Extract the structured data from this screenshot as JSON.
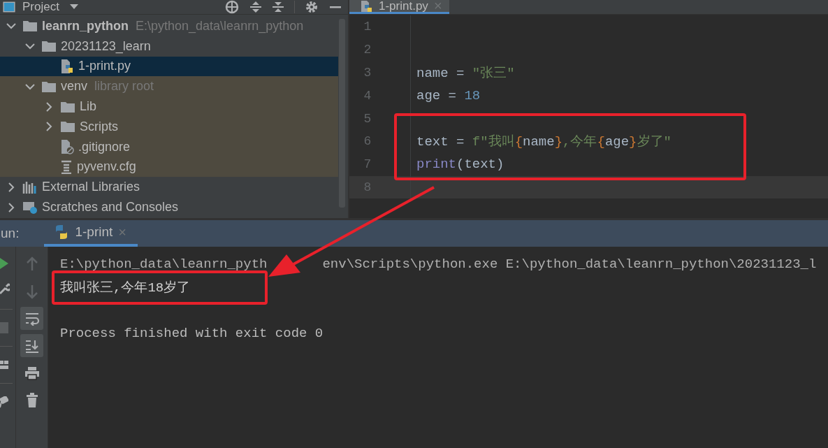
{
  "project_panel": {
    "title": "Project",
    "tree": [
      {
        "label": "leanrn_python",
        "hint": "E:\\python_data\\leanrn_python",
        "kind": "root",
        "expanded": true,
        "selected": false,
        "library": false,
        "children": [
          {
            "label": "20231123_learn",
            "kind": "folder",
            "expanded": true,
            "selected": false,
            "library": false,
            "children": [
              {
                "label": "1-print.py",
                "kind": "python",
                "selected": true
              }
            ]
          },
          {
            "label": "venv",
            "hint": "library root",
            "kind": "folder",
            "expanded": true,
            "selected": false,
            "library": true,
            "children": [
              {
                "label": "Lib",
                "kind": "folder",
                "expanded": false,
                "selected": false,
                "library": true
              },
              {
                "label": "Scripts",
                "kind": "folder",
                "expanded": false,
                "selected": false,
                "library": true
              },
              {
                "label": ".gitignore",
                "kind": "ignore",
                "selected": false,
                "library": true
              },
              {
                "label": "pyvenv.cfg",
                "kind": "config",
                "selected": false,
                "library": true
              }
            ]
          }
        ]
      },
      {
        "label": "External Libraries",
        "kind": "libraries",
        "expanded": false,
        "selected": false,
        "library": false
      },
      {
        "label": "Scratches and Consoles",
        "kind": "scratches",
        "expanded": false,
        "selected": false,
        "library": false
      }
    ]
  },
  "editor": {
    "tab": {
      "label": "1-print.py",
      "close": "×",
      "selected": true
    },
    "lines": [
      {
        "number": "1",
        "current": false
      },
      {
        "number": "2",
        "current": false
      },
      {
        "number": "3",
        "current": false,
        "tokens": [
          {
            "text": "name = ",
            "kind": "plain"
          },
          {
            "text": "\"张三\"",
            "kind": "string"
          }
        ]
      },
      {
        "number": "4",
        "current": false,
        "tokens": [
          {
            "text": "age = ",
            "kind": "plain"
          },
          {
            "text": "18",
            "kind": "number"
          }
        ]
      },
      {
        "number": "5",
        "current": false
      },
      {
        "number": "6",
        "current": false,
        "tokens": [
          {
            "text": "text = ",
            "kind": "plain"
          },
          {
            "text": "f\"我叫",
            "kind": "string"
          },
          {
            "text": "{",
            "kind": "brace"
          },
          {
            "text": "name",
            "kind": "plain"
          },
          {
            "text": "}",
            "kind": "brace"
          },
          {
            "text": ",今年",
            "kind": "string"
          },
          {
            "text": "{",
            "kind": "brace"
          },
          {
            "text": "age",
            "kind": "plain"
          },
          {
            "text": "}",
            "kind": "brace"
          },
          {
            "text": "岁了\"",
            "kind": "string"
          }
        ]
      },
      {
        "number": "7",
        "current": false,
        "tokens": [
          {
            "text": "print",
            "kind": "builtin"
          },
          {
            "text": "(text)",
            "kind": "plain"
          }
        ]
      },
      {
        "number": "8",
        "current": true
      }
    ]
  },
  "run_panel": {
    "label": "un:",
    "tab": {
      "label": "1-print",
      "close": "×",
      "selected": true
    },
    "console_toolbar": [
      {
        "on": false
      },
      {
        "on": false
      },
      {
        "on": true
      },
      {
        "on": true
      },
      {
        "on": false
      },
      {
        "on": false
      }
    ],
    "output": [
      {
        "parts": [
          "E:\\python_data\\leanrn_pyth",
          "env\\Scripts\\python.exe E:\\python_data\\leanrn_python\\20231123_l"
        ],
        "kind": "command"
      },
      {
        "text": "我叫张三,今年18岁了",
        "kind": "output"
      },
      {
        "kind": "blank"
      },
      {
        "text": "Process finished with exit code 0",
        "kind": "status"
      }
    ]
  }
}
